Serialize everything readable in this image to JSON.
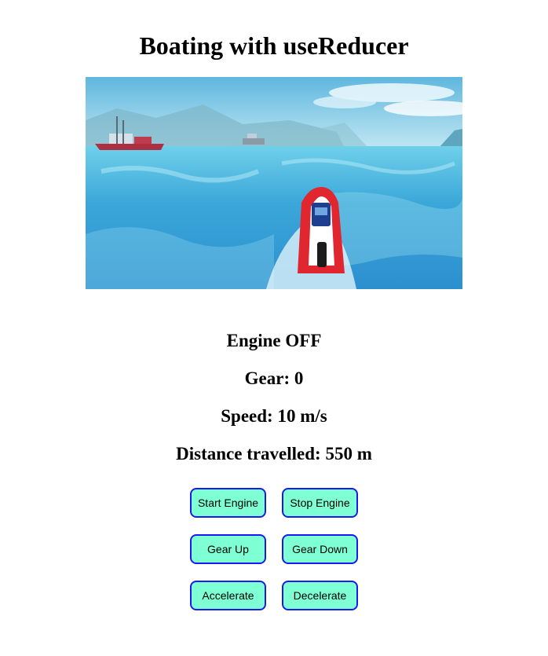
{
  "page": {
    "title": "Boating with useReducer"
  },
  "hero_image": {
    "alt": "red speedboat on blue sea",
    "colors": {
      "sky": "#8fd0e8",
      "water": "#3aa6d6",
      "boat_hull": "#e0262f"
    }
  },
  "status": {
    "engine": "Engine OFF",
    "gear": "Gear: 0",
    "speed": "Speed: 10 m/s",
    "distance": "Distance travelled: 550 m"
  },
  "controls": {
    "start_engine": "Start Engine",
    "stop_engine": "Stop Engine",
    "gear_up": "Gear Up",
    "gear_down": "Gear Down",
    "accelerate": "Accelerate",
    "decelerate": "Decelerate"
  },
  "theme": {
    "button_bg": "#7fffd4",
    "button_border": "#1a1aef"
  }
}
